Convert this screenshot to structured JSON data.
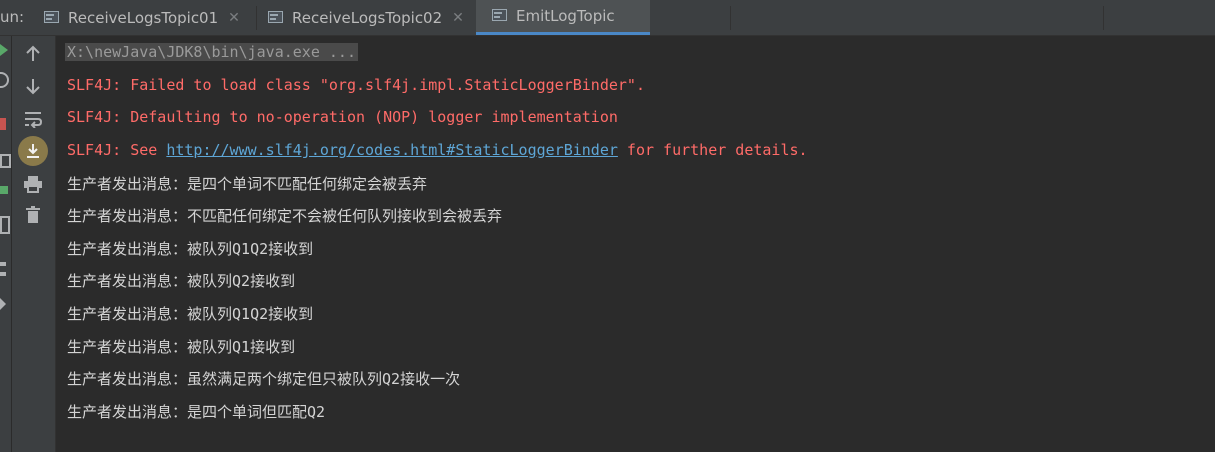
{
  "run_label": "un:",
  "tabs": [
    {
      "label": "ReceiveLogsTopic01",
      "active": false
    },
    {
      "label": "ReceiveLogsTopic02",
      "active": false
    },
    {
      "label": "EmitLogTopic",
      "active": true
    }
  ],
  "console": {
    "command": "X:\\newJava\\JDK8\\bin\\java.exe ...",
    "errors": [
      "SLF4J: Failed to load class \"org.slf4j.impl.StaticLoggerBinder\".",
      "SLF4J: Defaulting to no-operation (NOP) logger implementation"
    ],
    "see_line": {
      "prefix": "SLF4J: See ",
      "link": "http://www.slf4j.org/codes.html#StaticLoggerBinder",
      "suffix": " for further details."
    },
    "output": [
      "生产者发出消息：是四个单词不匹配任何绑定会被丢弃",
      "生产者发出消息：不匹配任何绑定不会被任何队列接收到会被丢弃",
      "生产者发出消息：被队列Q1Q2接收到",
      "生产者发出消息：被队列Q2接收到",
      "生产者发出消息：被队列Q1Q2接收到",
      "生产者发出消息：被队列Q1接收到",
      "生产者发出消息：虽然满足两个绑定但只被队列Q2接收一次",
      "生产者发出消息：是四个单词但匹配Q2"
    ]
  },
  "colors": {
    "error": "#ff6b68",
    "link": "#5ea6d6",
    "active_tab_underline": "#4a88c7"
  },
  "tool_icons": [
    "arrow-up-icon",
    "arrow-down-icon",
    "soft-wrap-icon",
    "scroll-to-end-icon",
    "print-icon",
    "trash-icon"
  ]
}
